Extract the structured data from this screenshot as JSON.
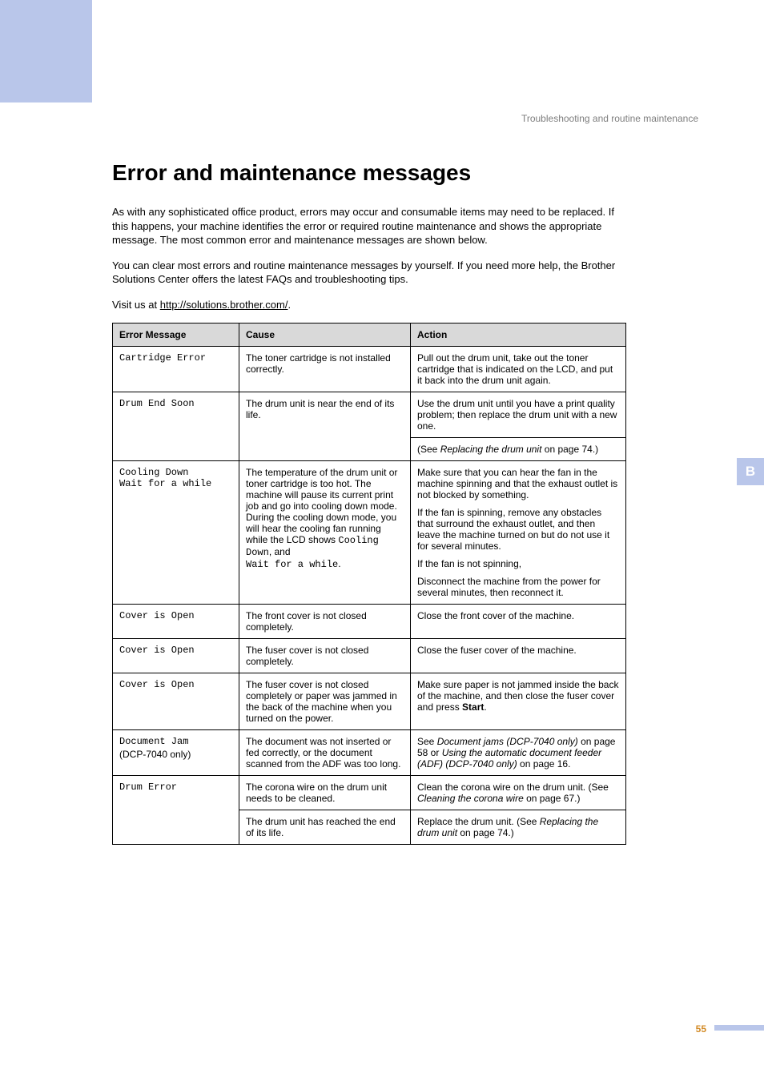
{
  "breadcrumb": "Troubleshooting and routine maintenance",
  "heading": "Error and maintenance messages",
  "intro1": "As with any sophisticated office product, errors may occur and consumable items may need to be replaced. If this happens, your machine identifies the error or required routine maintenance and shows the appropriate message. The most common error and maintenance messages are shown below.",
  "intro2": "You can clear most errors and routine maintenance messages by yourself. If you need more help, the Brother Solutions Center offers the latest FAQs and troubleshooting tips.",
  "visit_prefix": "Visit us at ",
  "visit_link": "http://solutions.brother.com/",
  "visit_suffix": ".",
  "side_tab": "B",
  "page_number": "55",
  "table": {
    "headers": {
      "msg": "Error Message",
      "cause": "Cause",
      "action": "Action"
    },
    "rows": {
      "r1": {
        "msg": "Cartridge Error",
        "cause": "The toner cartridge is not installed correctly.",
        "action": "Pull out the drum unit, take out the toner cartridge that is indicated on the LCD, and put it back into the drum unit again."
      },
      "r2": {
        "msg": "Drum End Soon",
        "cause": "The drum unit is near the end of its life.",
        "action_p1": "Use the drum unit until you have a print quality problem; then replace the drum unit with a new one.",
        "action_p2a": "(See ",
        "action_p2b": "Replacing the drum unit",
        "action_p2c": " on page 74.)"
      },
      "r3": {
        "msg_l1": "Cooling Down",
        "msg_l2": "Wait for a while",
        "cause_a": "The temperature of the drum unit or toner cartridge is too hot. The machine will pause its current print job and go into cooling down mode. During the cooling down mode, you will hear the cooling fan running while the LCD shows ",
        "cause_b": "Cooling Down",
        "cause_c": ", and ",
        "cause_d": "Wait for a while",
        "cause_e": ".",
        "action_p1": "Make sure that you can hear the fan in the machine spinning and that the exhaust outlet is not blocked by something.",
        "action_p2": "If the fan is spinning, remove any obstacles that surround the exhaust outlet, and then leave the machine turned on but do not use it for several minutes.",
        "action_p3": "If the fan is not spinning,",
        "action_p4": "Disconnect the machine from the power for several minutes, then reconnect it."
      },
      "r4": {
        "msg": "Cover is Open",
        "cause": "The front cover is not closed completely.",
        "action": "Close the front cover of the machine."
      },
      "r5": {
        "msg": "Cover is Open",
        "cause": "The fuser cover is not closed completely.",
        "action": "Close the fuser cover of the machine."
      },
      "r6": {
        "msg": "Cover is Open",
        "cause": "The fuser cover is not closed completely or paper was jammed in the back of the machine when you turned on the power.",
        "action_a": "Make sure paper is not jammed inside the back of the machine, and then close the fuser cover and press ",
        "action_b": "Start",
        "action_c": "."
      },
      "r7": {
        "msg": "Document Jam",
        "msg_note": "(DCP-7040 only)",
        "cause": "The document was not inserted or fed correctly, or the document scanned from the ADF was too long.",
        "action_a": "See ",
        "action_b": "Document jams  (DCP-7040 only)",
        "action_c": " on page 58 or ",
        "action_d": "Using the automatic document feeder (ADF)  (DCP-7040 only)",
        "action_e": " on page 16."
      },
      "r8": {
        "msg": "Drum Error",
        "cause1": "The corona wire on the drum unit needs to be cleaned.",
        "action1_a": "Clean the corona wire on the drum unit. (See ",
        "action1_b": "Cleaning the corona wire",
        "action1_c": " on page 67.)",
        "cause2": "The drum unit has reached the end of its life.",
        "action2_a": "Replace the drum unit. (See ",
        "action2_b": "Replacing the drum unit",
        "action2_c": " on page 74.)"
      }
    }
  }
}
